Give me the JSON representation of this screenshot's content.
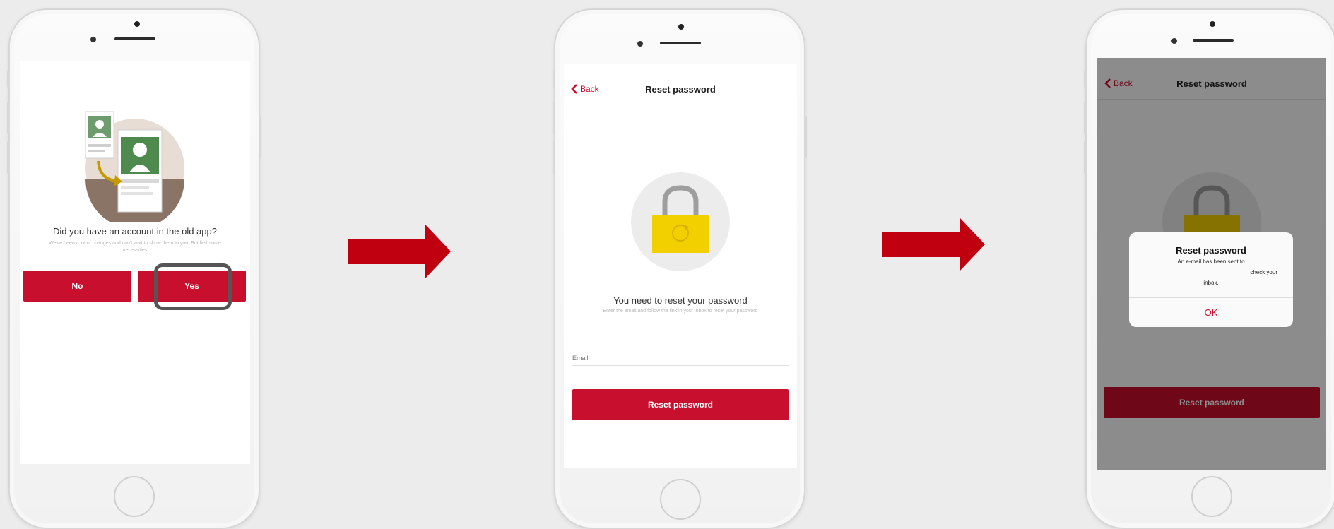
{
  "screen1": {
    "question": "Did you have an account in the old app?",
    "subtext": "We've been a lot of changes and can't wait to show them to you. But first some necessities",
    "no_label": "No",
    "yes_label": "Yes"
  },
  "screen2": {
    "back_label": "Back",
    "title": "Reset password",
    "heading": "You need to reset your password",
    "subtext": "Enter the email and follow the link in your inbox to reset your password",
    "email_placeholder": "Email",
    "button_label": "Reset password"
  },
  "screen3": {
    "back_label": "Back",
    "title": "Reset password",
    "button_label": "Reset password",
    "dialog_title": "Reset password",
    "dialog_message_line1": "An e-mail has been sent to",
    "dialog_message_line2": "check your",
    "dialog_message_line3": "inbox.",
    "dialog_ok": "OK"
  },
  "colors": {
    "brand_red": "#c8102e",
    "arrow_red": "#c00010",
    "lock_yellow": "#f2d000",
    "background": "#ececec"
  },
  "icons": {
    "arrow": "right-arrow-icon",
    "lock": "lock-icon",
    "back": "chevron-left-icon",
    "illustration": "account-transfer-illustration"
  }
}
